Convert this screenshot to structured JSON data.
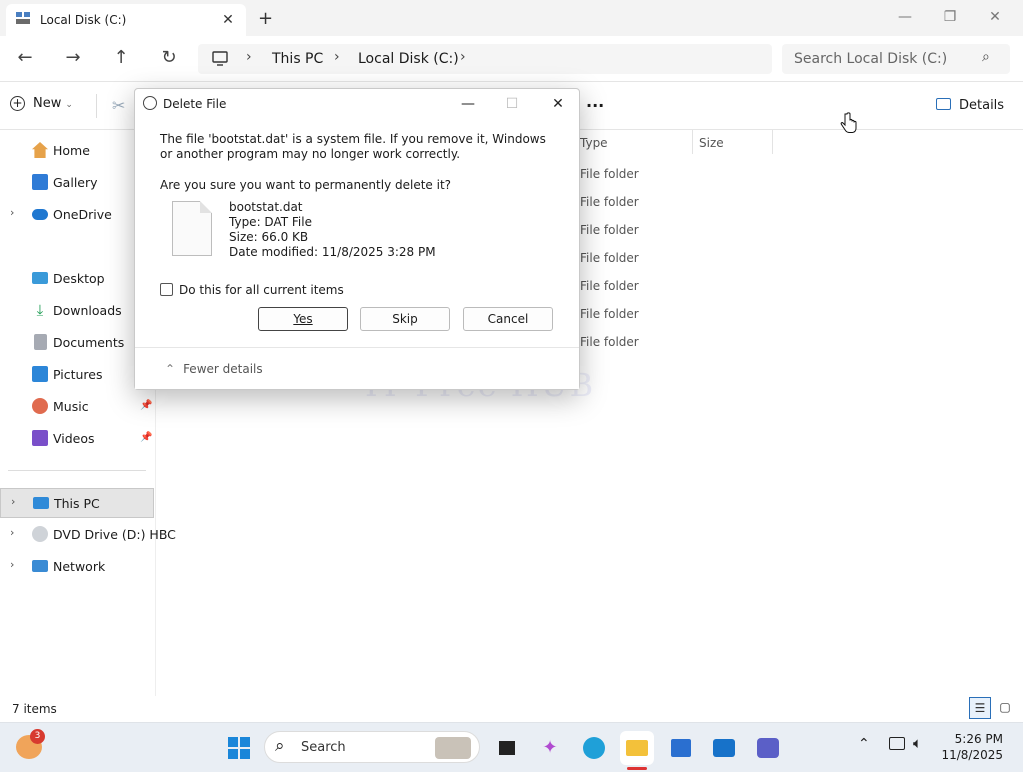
{
  "window": {
    "tab_title": "Local Disk (C:)",
    "close_glyph": "✕",
    "new_tab_glyph": "+"
  },
  "address": {
    "crumbs": [
      "This PC",
      "Local Disk (C:)"
    ]
  },
  "search": {
    "placeholder": "Search Local Disk (C:)"
  },
  "command_bar": {
    "new_label": "New",
    "more_label": "...",
    "details_label": "Details"
  },
  "sidebar": {
    "items": [
      {
        "label": "Home",
        "icon": "home-icon"
      },
      {
        "label": "Gallery",
        "icon": "gallery-icon"
      },
      {
        "label": "OneDrive",
        "icon": "cloud-icon"
      },
      {
        "label": "Desktop",
        "icon": "desktop-icon"
      },
      {
        "label": "Downloads",
        "icon": "download-icon"
      },
      {
        "label": "Documents",
        "icon": "documents-icon"
      },
      {
        "label": "Pictures",
        "icon": "pictures-icon"
      },
      {
        "label": "Music",
        "icon": "music-icon"
      },
      {
        "label": "Videos",
        "icon": "videos-icon"
      },
      {
        "label": "This PC",
        "icon": "pc-icon"
      },
      {
        "label": "DVD Drive (D:) HBC",
        "icon": "dvd-icon"
      },
      {
        "label": "Network",
        "icon": "network-icon"
      }
    ]
  },
  "file_list": {
    "columns": [
      "Type",
      "Size"
    ],
    "rows": [
      "File folder",
      "File folder",
      "File folder",
      "File folder",
      "File folder",
      "File folder",
      "File folder"
    ]
  },
  "watermark": "IT Free HUB",
  "status": {
    "item_count": "7 items"
  },
  "dialog": {
    "title": "Delete File",
    "warning": "The file 'bootstat.dat' is a system file. If you remove it, Windows or another program may no longer work correctly.",
    "question": "Are you sure you want to permanently delete it?",
    "file_name": "bootstat.dat",
    "file_type": "Type: DAT File",
    "file_size": "Size: 66.0 KB",
    "file_modified": "Date modified: 11/8/2025 3:28 PM",
    "checkbox_label": "Do this for all current items",
    "yes_label": "Yes",
    "skip_label": "Skip",
    "cancel_label": "Cancel",
    "fewer_details_label": "Fewer details"
  },
  "taskbar": {
    "search_label": "Search",
    "badge_count": "3",
    "time": "5:26 PM",
    "date": "11/8/2025"
  }
}
